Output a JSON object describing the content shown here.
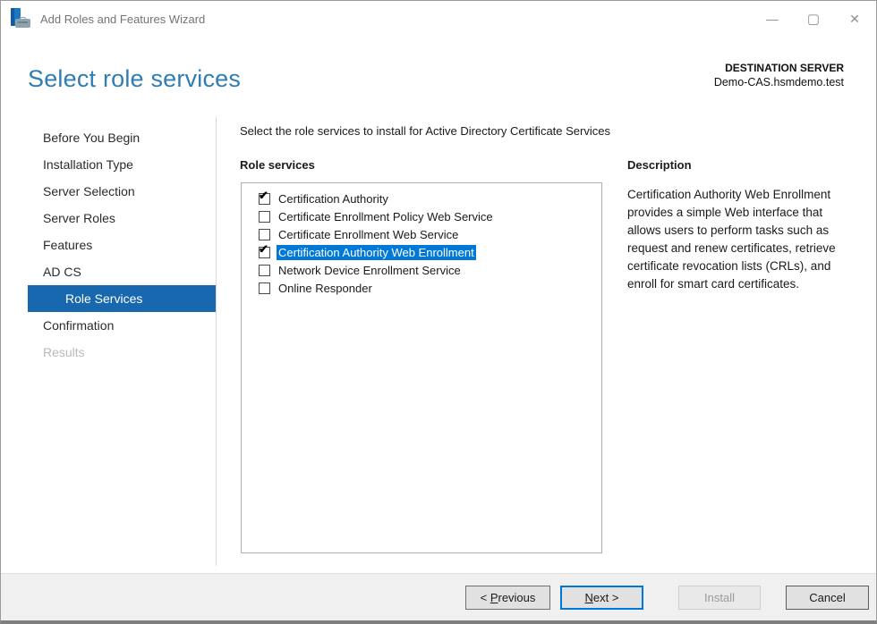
{
  "window": {
    "title": "Add Roles and Features Wizard"
  },
  "icons": {
    "minimize": "—",
    "maximize": "▢",
    "close": "✕",
    "check": "✔"
  },
  "header": {
    "title": "Select role services",
    "destination_label": "DESTINATION SERVER",
    "destination_server": "Demo-CAS.hsmdemo.test"
  },
  "sidebar": {
    "items": [
      {
        "label": "Before You Begin",
        "state": "normal"
      },
      {
        "label": "Installation Type",
        "state": "normal"
      },
      {
        "label": "Server Selection",
        "state": "normal"
      },
      {
        "label": "Server Roles",
        "state": "normal"
      },
      {
        "label": "Features",
        "state": "normal"
      },
      {
        "label": "AD CS",
        "state": "normal"
      },
      {
        "label": "Role Services",
        "state": "selected"
      },
      {
        "label": "Confirmation",
        "state": "normal"
      },
      {
        "label": "Results",
        "state": "disabled"
      }
    ]
  },
  "main": {
    "instruction": "Select the role services to install for Active Directory Certificate Services",
    "list_label": "Role services",
    "role_services": [
      {
        "label": "Certification Authority",
        "checked": true,
        "selected": false
      },
      {
        "label": "Certificate Enrollment Policy Web Service",
        "checked": false,
        "selected": false
      },
      {
        "label": "Certificate Enrollment Web Service",
        "checked": false,
        "selected": false
      },
      {
        "label": "Certification Authority Web Enrollment",
        "checked": true,
        "selected": true
      },
      {
        "label": "Network Device Enrollment Service",
        "checked": false,
        "selected": false
      },
      {
        "label": "Online Responder",
        "checked": false,
        "selected": false
      }
    ]
  },
  "description": {
    "heading": "Description",
    "text": "Certification Authority Web Enrollment provides a simple Web interface that allows users to perform tasks such as request and renew certificates, retrieve certificate revocation lists (CRLs), and enroll for smart card certificates."
  },
  "footer": {
    "previous": {
      "pre": "< ",
      "key": "P",
      "post": "revious"
    },
    "next": {
      "pre": "",
      "key": "N",
      "post": "ext >"
    },
    "install": {
      "label": "Install"
    },
    "cancel": {
      "label": "Cancel"
    }
  },
  "colors": {
    "heading_blue": "#2e7db3",
    "sidebar_selected_bg": "#1768ae",
    "selection_bg": "#0078d7",
    "footer_bg": "#f0f0f0"
  }
}
